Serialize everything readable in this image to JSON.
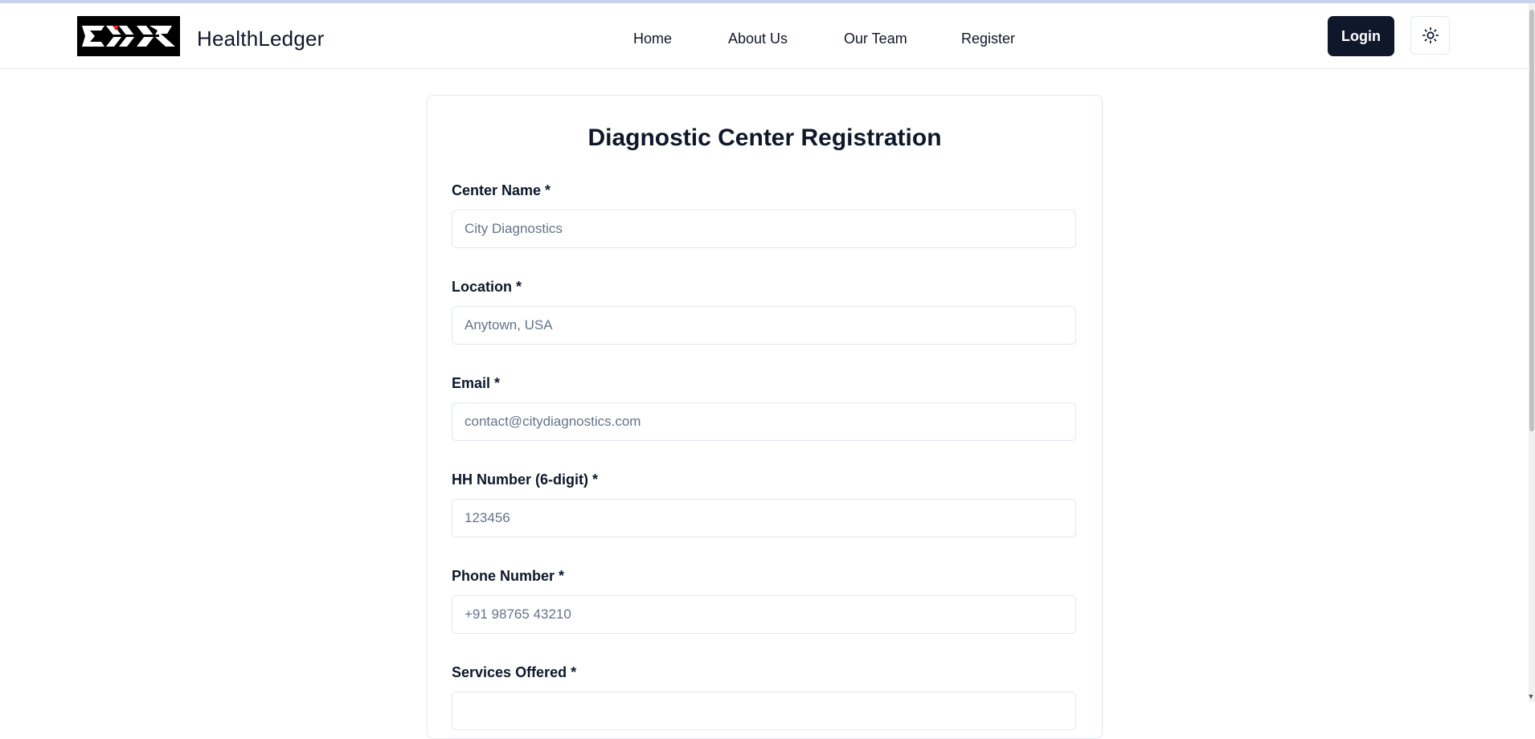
{
  "header": {
    "brand": "HealthLedger",
    "nav": [
      {
        "label": "Home"
      },
      {
        "label": "About Us"
      },
      {
        "label": "Our Team"
      },
      {
        "label": "Register"
      }
    ],
    "login_label": "Login",
    "theme_icon": "sun-icon"
  },
  "form": {
    "title": "Diagnostic Center Registration",
    "fields": [
      {
        "label": "Center Name *",
        "placeholder": "City Diagnostics",
        "value": ""
      },
      {
        "label": "Location *",
        "placeholder": "Anytown, USA",
        "value": ""
      },
      {
        "label": "Email *",
        "placeholder": "contact@citydiagnostics.com",
        "value": ""
      },
      {
        "label": "HH Number (6-digit) *",
        "placeholder": "123456",
        "value": ""
      },
      {
        "label": "Phone Number *",
        "placeholder": "+91 98765 43210",
        "value": ""
      },
      {
        "label": "Services Offered *",
        "placeholder": "",
        "value": ""
      }
    ]
  },
  "colors": {
    "primary": "#0f172a",
    "border": "#e2e8f0",
    "placeholder": "#64748b",
    "logo_accent": "#e3262e"
  }
}
